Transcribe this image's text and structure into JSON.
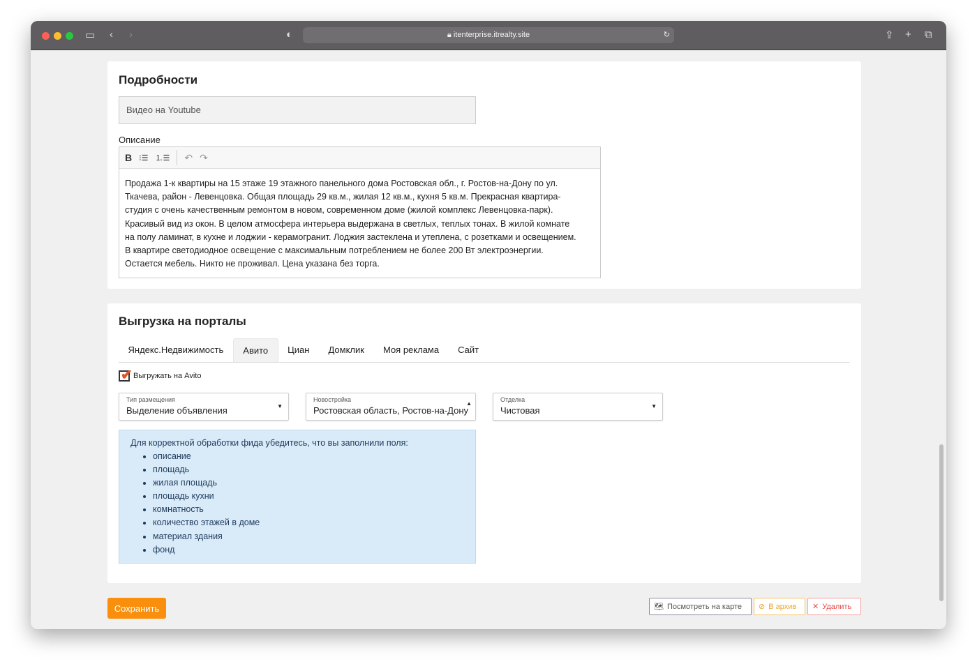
{
  "browser": {
    "url": "itenterprise.itrealty.site"
  },
  "details": {
    "title": "Подробности",
    "youtube_placeholder": "Видео на Youtube",
    "description_label": "Описание",
    "toolbar": {
      "bold": "B",
      "bullet": "⁝☰",
      "numbered": "⒈☰",
      "undo": "↶",
      "redo": "↷"
    },
    "description_lines": [
      "Продажа 1-к квартиры на 15 этаже 19 этажного панельного дома Ростовская обл., г. Ростов-на-Дону по ул.",
      "Ткачева, район - Левенцовка. Общая площадь 29 кв.м., жилая 12 кв.м., кухня 5 кв.м. Прекрасная квартира-",
      "студия с очень качественным ремонтом в новом, современном доме (жилой комплекс Левенцовка-парк).",
      "Красивый вид из окон. В целом атмосфера интерьера выдержана в светлых, теплых тонах. В жилой комнате",
      "на полу ламинат, в кухне и лоджии - керамогранит. Лоджия застеклена и утеплена, с розетками и освещением.",
      "В квартире светодиодное освещение с максимальным потреблением не более 200 Вт электроэнергии.",
      "Остается мебель. Никто не проживал. Цена указана без торга."
    ]
  },
  "export": {
    "title": "Выгрузка на порталы",
    "tabs": [
      "Яндекс.Недвижимость",
      "Авито",
      "Циан",
      "Домклик",
      "Моя реклама",
      "Сайт"
    ],
    "active_tab": "Авито",
    "checkbox_label": "Выгружать на Avito",
    "selects": [
      {
        "label": "Тип размещения",
        "value": "Выделение объявления"
      },
      {
        "label": "Новостройка",
        "value": "Ростовская область, Ростов-на-Дону,"
      },
      {
        "label": "Отделка",
        "value": "Чистовая"
      }
    ],
    "info": {
      "text": "Для корректной обработки фида убедитесь, что вы заполнили поля:",
      "items": [
        "описание",
        "площадь",
        "жилая площадь",
        "площадь кухни",
        "комнатность",
        "количество этажей в доме",
        "материал здания",
        "фонд"
      ]
    }
  },
  "actions": {
    "save": "Сохранить",
    "map": "Посмотреть на карте",
    "archive": "В архив",
    "delete": "Удалить"
  },
  "colors": {
    "accent": "#f98f0c",
    "info_bg": "#d9eaf9"
  }
}
